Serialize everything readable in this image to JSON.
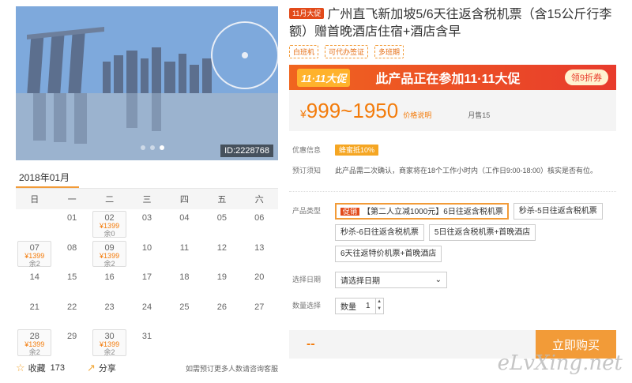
{
  "gallery": {
    "image_id": "ID:2228768",
    "dots": 3,
    "active_dot": 2
  },
  "calendar": {
    "month_label": "2018年01月",
    "weekdays": [
      "日",
      "一",
      "二",
      "三",
      "四",
      "五",
      "六"
    ],
    "cells": [
      {
        "d": ""
      },
      {
        "d": "01"
      },
      {
        "d": "02",
        "price": "¥1399",
        "left": "余0"
      },
      {
        "d": "03"
      },
      {
        "d": "04"
      },
      {
        "d": "05"
      },
      {
        "d": "06"
      },
      {
        "d": "07",
        "price": "¥1399",
        "left": "余2"
      },
      {
        "d": "08"
      },
      {
        "d": "09",
        "price": "¥1399",
        "left": "余2"
      },
      {
        "d": "10"
      },
      {
        "d": "11"
      },
      {
        "d": "12"
      },
      {
        "d": "13"
      },
      {
        "d": "14"
      },
      {
        "d": "15"
      },
      {
        "d": "16"
      },
      {
        "d": "17"
      },
      {
        "d": "18"
      },
      {
        "d": "19"
      },
      {
        "d": "20"
      },
      {
        "d": "21"
      },
      {
        "d": "22"
      },
      {
        "d": "23"
      },
      {
        "d": "24"
      },
      {
        "d": "25"
      },
      {
        "d": "26"
      },
      {
        "d": "27"
      },
      {
        "d": "28",
        "price": "¥1399",
        "left": "余2"
      },
      {
        "d": "29"
      },
      {
        "d": "30",
        "price": "¥1399",
        "left": "余2"
      },
      {
        "d": "31"
      },
      {
        "d": ""
      },
      {
        "d": ""
      },
      {
        "d": ""
      }
    ]
  },
  "footer": {
    "fav_label": "收藏",
    "fav_count": "173",
    "share_label": "分享",
    "note": "如需预订更多人数请咨询客服"
  },
  "product": {
    "badge": "11月大促",
    "title": "广州直飞新加坡5/6天往返含税机票（含15公斤行李额）赠首晚酒店住宿+酒店含早",
    "tags": [
      "白班机",
      "可代办签证",
      "多班期"
    ]
  },
  "promo": {
    "logo": "11·11大促",
    "text": "此产品正在参加11·11大促",
    "coupon": "领9折券"
  },
  "price": {
    "range": "999~1950",
    "currency": "¥",
    "explain": "价格说明",
    "sold": "月售15"
  },
  "info": {
    "discount_key": "优惠信息",
    "discount_val": "蜂蜜抵10%",
    "notice_key": "预订须知",
    "notice_val": "此产品需二次确认，商家将在18个工作小时内（工作日9:00-18:00）核实是否有位。"
  },
  "options": {
    "type_key": "产品类型",
    "items": [
      {
        "tag": "促销",
        "label": "【第二人立减1000元】6日往返含税机票",
        "selected": true
      },
      {
        "label": "秒杀-5日往返含税机票"
      },
      {
        "label": "秒杀-6日往返含税机票"
      },
      {
        "label": "5日往返含税机票+首晚酒店"
      },
      {
        "label": "6天往返特价机票+首晚酒店"
      }
    ],
    "date_key": "选择日期",
    "date_placeholder": "请选择日期",
    "qty_key": "数量选择",
    "qty_label": "数量",
    "qty_value": "1"
  },
  "buy": {
    "total": "--",
    "button": "立即购买"
  },
  "watermark": "eLvXing.net",
  "colors": {
    "accent": "#f29b38",
    "price": "#f37b0a",
    "promo": "#e83b2c"
  }
}
